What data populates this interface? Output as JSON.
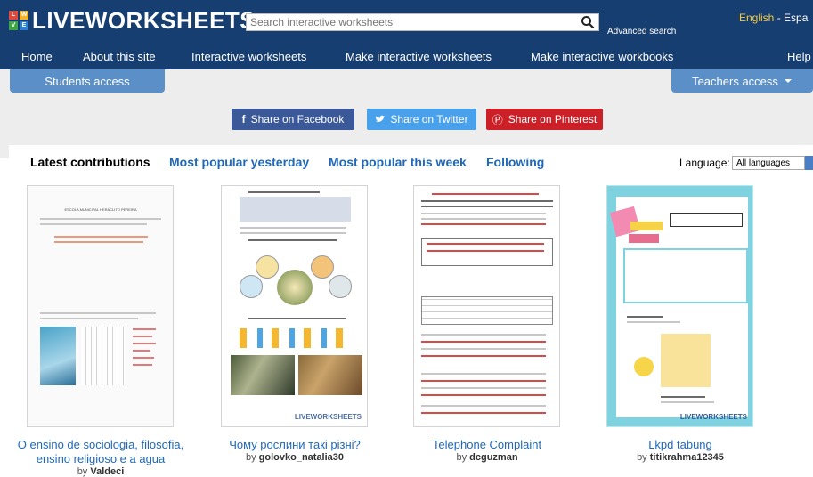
{
  "header": {
    "logo_text": "LIVEWORKSHEETS",
    "logo_tiles": [
      "L",
      "W",
      "V",
      "E"
    ],
    "search_placeholder": "Search interactive worksheets",
    "advanced_search": "Advanced search",
    "lang_english": "English",
    "lang_sep": "-",
    "lang_espanol": "Espa"
  },
  "nav": {
    "items": [
      "Home",
      "About this site",
      "Interactive worksheets",
      "Make interactive worksheets",
      "Make interactive workbooks",
      "Help"
    ]
  },
  "tabs": {
    "students": "Students access",
    "teachers": "Teachers access"
  },
  "share": {
    "facebook": "Share on Facebook",
    "twitter": "Share on Twitter",
    "pinterest": "Share on Pinterest"
  },
  "content_tabs": [
    "Latest contributions",
    "Most popular yesterday",
    "Most popular this week",
    "Following"
  ],
  "language_filter": {
    "label": "Language:",
    "value": "All languages"
  },
  "cards": [
    {
      "title_line1": "O ensino de sociologia, filosofia,",
      "title_line2": "ensino religioso e a agua",
      "by": "by",
      "author": "Valdeci"
    },
    {
      "title_line1": "Чому рослини такі різні?",
      "title_line2": "",
      "by": "by",
      "author": "golovko_natalia30"
    },
    {
      "title_line1": "Telephone Complaint",
      "title_line2": "",
      "by": "by",
      "author": "dcguzman"
    },
    {
      "title_line1": "Lkpd tabung",
      "title_line2": "",
      "by": "by",
      "author": "titikrahma12345"
    }
  ],
  "thumbnail_text": {
    "school_header": "ESCOLA MUNICIPAL HERÁCLITO PEREIRA",
    "watermark": "LIVEWORKSHEETS"
  },
  "colors": {
    "header_bg": "#173e70",
    "tab_bg": "#5a8fc7",
    "link": "#2168b7",
    "facebook": "#3b5998",
    "twitter": "#4aa1eb",
    "pinterest": "#cb2027",
    "lang_link": "#f4c93a"
  }
}
